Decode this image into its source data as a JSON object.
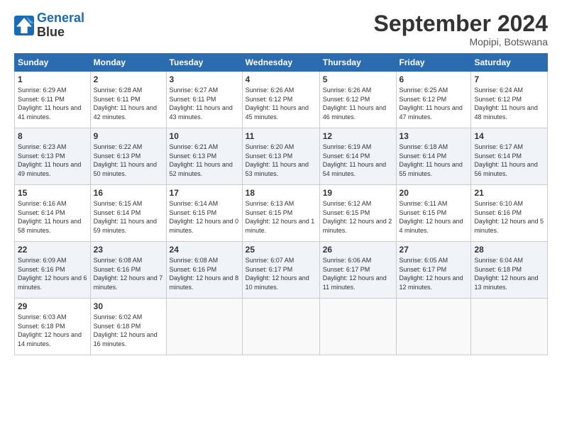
{
  "logo": {
    "line1": "General",
    "line2": "Blue"
  },
  "title": "September 2024",
  "location": "Mopipi, Botswana",
  "days_of_week": [
    "Sunday",
    "Monday",
    "Tuesday",
    "Wednesday",
    "Thursday",
    "Friday",
    "Saturday"
  ],
  "weeks": [
    [
      {
        "day": "1",
        "sunrise": "6:29 AM",
        "sunset": "6:11 PM",
        "daylight": "11 hours and 41 minutes."
      },
      {
        "day": "2",
        "sunrise": "6:28 AM",
        "sunset": "6:11 PM",
        "daylight": "11 hours and 42 minutes."
      },
      {
        "day": "3",
        "sunrise": "6:27 AM",
        "sunset": "6:11 PM",
        "daylight": "11 hours and 43 minutes."
      },
      {
        "day": "4",
        "sunrise": "6:26 AM",
        "sunset": "6:12 PM",
        "daylight": "11 hours and 45 minutes."
      },
      {
        "day": "5",
        "sunrise": "6:26 AM",
        "sunset": "6:12 PM",
        "daylight": "11 hours and 46 minutes."
      },
      {
        "day": "6",
        "sunrise": "6:25 AM",
        "sunset": "6:12 PM",
        "daylight": "11 hours and 47 minutes."
      },
      {
        "day": "7",
        "sunrise": "6:24 AM",
        "sunset": "6:12 PM",
        "daylight": "11 hours and 48 minutes."
      }
    ],
    [
      {
        "day": "8",
        "sunrise": "6:23 AM",
        "sunset": "6:13 PM",
        "daylight": "11 hours and 49 minutes."
      },
      {
        "day": "9",
        "sunrise": "6:22 AM",
        "sunset": "6:13 PM",
        "daylight": "11 hours and 50 minutes."
      },
      {
        "day": "10",
        "sunrise": "6:21 AM",
        "sunset": "6:13 PM",
        "daylight": "11 hours and 52 minutes."
      },
      {
        "day": "11",
        "sunrise": "6:20 AM",
        "sunset": "6:13 PM",
        "daylight": "11 hours and 53 minutes."
      },
      {
        "day": "12",
        "sunrise": "6:19 AM",
        "sunset": "6:14 PM",
        "daylight": "11 hours and 54 minutes."
      },
      {
        "day": "13",
        "sunrise": "6:18 AM",
        "sunset": "6:14 PM",
        "daylight": "11 hours and 55 minutes."
      },
      {
        "day": "14",
        "sunrise": "6:17 AM",
        "sunset": "6:14 PM",
        "daylight": "11 hours and 56 minutes."
      }
    ],
    [
      {
        "day": "15",
        "sunrise": "6:16 AM",
        "sunset": "6:14 PM",
        "daylight": "11 hours and 58 minutes."
      },
      {
        "day": "16",
        "sunrise": "6:15 AM",
        "sunset": "6:14 PM",
        "daylight": "11 hours and 59 minutes."
      },
      {
        "day": "17",
        "sunrise": "6:14 AM",
        "sunset": "6:15 PM",
        "daylight": "12 hours and 0 minutes."
      },
      {
        "day": "18",
        "sunrise": "6:13 AM",
        "sunset": "6:15 PM",
        "daylight": "12 hours and 1 minute."
      },
      {
        "day": "19",
        "sunrise": "6:12 AM",
        "sunset": "6:15 PM",
        "daylight": "12 hours and 2 minutes."
      },
      {
        "day": "20",
        "sunrise": "6:11 AM",
        "sunset": "6:15 PM",
        "daylight": "12 hours and 4 minutes."
      },
      {
        "day": "21",
        "sunrise": "6:10 AM",
        "sunset": "6:16 PM",
        "daylight": "12 hours and 5 minutes."
      }
    ],
    [
      {
        "day": "22",
        "sunrise": "6:09 AM",
        "sunset": "6:16 PM",
        "daylight": "12 hours and 6 minutes."
      },
      {
        "day": "23",
        "sunrise": "6:08 AM",
        "sunset": "6:16 PM",
        "daylight": "12 hours and 7 minutes."
      },
      {
        "day": "24",
        "sunrise": "6:08 AM",
        "sunset": "6:16 PM",
        "daylight": "12 hours and 8 minutes."
      },
      {
        "day": "25",
        "sunrise": "6:07 AM",
        "sunset": "6:17 PM",
        "daylight": "12 hours and 10 minutes."
      },
      {
        "day": "26",
        "sunrise": "6:06 AM",
        "sunset": "6:17 PM",
        "daylight": "12 hours and 11 minutes."
      },
      {
        "day": "27",
        "sunrise": "6:05 AM",
        "sunset": "6:17 PM",
        "daylight": "12 hours and 12 minutes."
      },
      {
        "day": "28",
        "sunrise": "6:04 AM",
        "sunset": "6:18 PM",
        "daylight": "12 hours and 13 minutes."
      }
    ],
    [
      {
        "day": "29",
        "sunrise": "6:03 AM",
        "sunset": "6:18 PM",
        "daylight": "12 hours and 14 minutes."
      },
      {
        "day": "30",
        "sunrise": "6:02 AM",
        "sunset": "6:18 PM",
        "daylight": "12 hours and 16 minutes."
      },
      null,
      null,
      null,
      null,
      null
    ]
  ]
}
